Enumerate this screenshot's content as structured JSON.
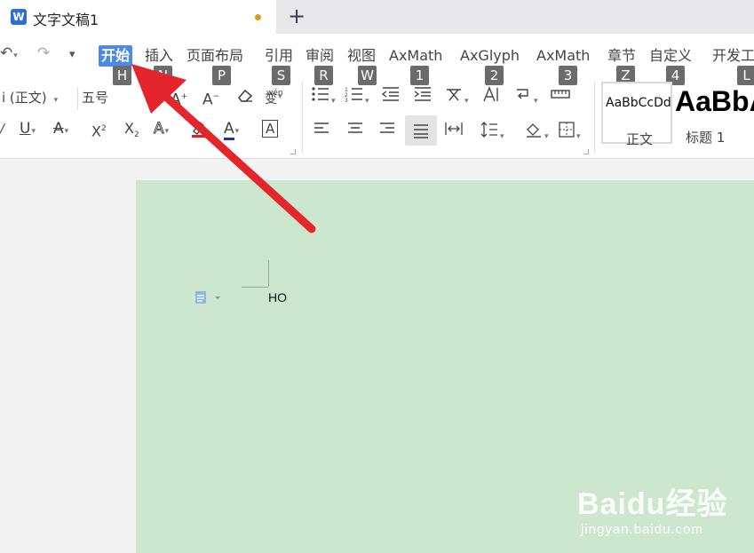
{
  "tabbar": {
    "doc_title": "文字文稿1",
    "new_tab": "+"
  },
  "quick_access": {
    "undo": "↶",
    "redo": "↷",
    "more": "▾"
  },
  "menu": {
    "tabs": [
      {
        "label": "开始",
        "keytip": "H"
      },
      {
        "label": "插入",
        "keytip": "N"
      },
      {
        "label": "页面布局",
        "keytip": "P"
      },
      {
        "label": "引用",
        "keytip": "S"
      },
      {
        "label": "审阅",
        "keytip": "R"
      },
      {
        "label": "视图",
        "keytip": "W"
      },
      {
        "label": "AxMath",
        "keytip": "1"
      },
      {
        "label": "AxGlyph",
        "keytip": "2"
      },
      {
        "label": "AxMath",
        "keytip": "3"
      },
      {
        "label": "章节",
        "keytip": "Z"
      },
      {
        "label": "自定义",
        "keytip": "4"
      },
      {
        "label": "开发工具",
        "keytip": "L"
      }
    ]
  },
  "font": {
    "name": "i (正文)",
    "size": "五号"
  },
  "styles": {
    "normal_preview": "AaBbCcDd",
    "normal_label": "正文",
    "h1_preview": "AaBbA",
    "h1_label": "标题 1"
  },
  "document": {
    "text": "HO"
  },
  "watermark": {
    "logo": "Baidu经验",
    "url": "jingyan.baidu.com"
  },
  "colors": {
    "accent": "#4d89e8",
    "page_bg": "#cde7ce",
    "arrow": "#e4252b",
    "keytip_bg": "#6b6b6b"
  }
}
